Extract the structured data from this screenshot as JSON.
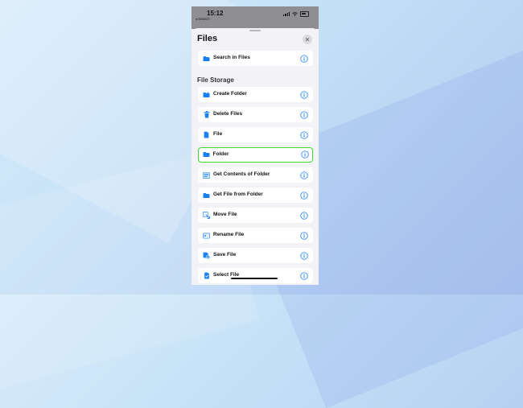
{
  "status_bar": {
    "time": "15:12",
    "back_app": "◂ Search"
  },
  "sheet": {
    "title": "Files",
    "section_header": "File Storage"
  },
  "search_row": {
    "label": "Search in Files",
    "icon": "folder-icon"
  },
  "actions": [
    {
      "label": "Create Folder",
      "icon": "create-folder-icon"
    },
    {
      "label": "Delete Files",
      "icon": "trash-icon"
    },
    {
      "label": "File",
      "icon": "file-icon"
    },
    {
      "label": "Folder",
      "icon": "folder-icon",
      "selected": true
    },
    {
      "label": "Get Contents of Folder",
      "icon": "list-icon"
    },
    {
      "label": "Get File from Folder",
      "icon": "folder-icon"
    },
    {
      "label": "Move File",
      "icon": "move-file-icon"
    },
    {
      "label": "Rename File",
      "icon": "rename-icon"
    },
    {
      "label": "Save File",
      "icon": "save-icon"
    },
    {
      "label": "Select File",
      "icon": "select-file-icon"
    }
  ],
  "colors": {
    "accent": "#1a7ff5",
    "highlight": "#3ddc2a",
    "icon_bg": "#e1eefc"
  }
}
